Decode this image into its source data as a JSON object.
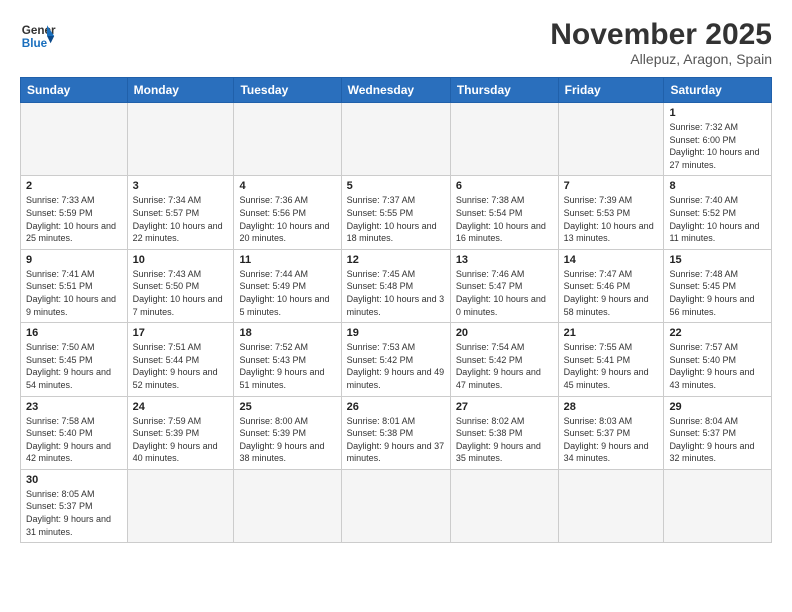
{
  "logo": {
    "line1": "General",
    "line2": "Blue"
  },
  "title": "November 2025",
  "location": "Allepuz, Aragon, Spain",
  "weekdays": [
    "Sunday",
    "Monday",
    "Tuesday",
    "Wednesday",
    "Thursday",
    "Friday",
    "Saturday"
  ],
  "weeks": [
    [
      {
        "day": "",
        "info": ""
      },
      {
        "day": "",
        "info": ""
      },
      {
        "day": "",
        "info": ""
      },
      {
        "day": "",
        "info": ""
      },
      {
        "day": "",
        "info": ""
      },
      {
        "day": "",
        "info": ""
      },
      {
        "day": "1",
        "info": "Sunrise: 7:32 AM\nSunset: 6:00 PM\nDaylight: 10 hours and 27 minutes."
      }
    ],
    [
      {
        "day": "2",
        "info": "Sunrise: 7:33 AM\nSunset: 5:59 PM\nDaylight: 10 hours and 25 minutes."
      },
      {
        "day": "3",
        "info": "Sunrise: 7:34 AM\nSunset: 5:57 PM\nDaylight: 10 hours and 22 minutes."
      },
      {
        "day": "4",
        "info": "Sunrise: 7:36 AM\nSunset: 5:56 PM\nDaylight: 10 hours and 20 minutes."
      },
      {
        "day": "5",
        "info": "Sunrise: 7:37 AM\nSunset: 5:55 PM\nDaylight: 10 hours and 18 minutes."
      },
      {
        "day": "6",
        "info": "Sunrise: 7:38 AM\nSunset: 5:54 PM\nDaylight: 10 hours and 16 minutes."
      },
      {
        "day": "7",
        "info": "Sunrise: 7:39 AM\nSunset: 5:53 PM\nDaylight: 10 hours and 13 minutes."
      },
      {
        "day": "8",
        "info": "Sunrise: 7:40 AM\nSunset: 5:52 PM\nDaylight: 10 hours and 11 minutes."
      }
    ],
    [
      {
        "day": "9",
        "info": "Sunrise: 7:41 AM\nSunset: 5:51 PM\nDaylight: 10 hours and 9 minutes."
      },
      {
        "day": "10",
        "info": "Sunrise: 7:43 AM\nSunset: 5:50 PM\nDaylight: 10 hours and 7 minutes."
      },
      {
        "day": "11",
        "info": "Sunrise: 7:44 AM\nSunset: 5:49 PM\nDaylight: 10 hours and 5 minutes."
      },
      {
        "day": "12",
        "info": "Sunrise: 7:45 AM\nSunset: 5:48 PM\nDaylight: 10 hours and 3 minutes."
      },
      {
        "day": "13",
        "info": "Sunrise: 7:46 AM\nSunset: 5:47 PM\nDaylight: 10 hours and 0 minutes."
      },
      {
        "day": "14",
        "info": "Sunrise: 7:47 AM\nSunset: 5:46 PM\nDaylight: 9 hours and 58 minutes."
      },
      {
        "day": "15",
        "info": "Sunrise: 7:48 AM\nSunset: 5:45 PM\nDaylight: 9 hours and 56 minutes."
      }
    ],
    [
      {
        "day": "16",
        "info": "Sunrise: 7:50 AM\nSunset: 5:45 PM\nDaylight: 9 hours and 54 minutes."
      },
      {
        "day": "17",
        "info": "Sunrise: 7:51 AM\nSunset: 5:44 PM\nDaylight: 9 hours and 52 minutes."
      },
      {
        "day": "18",
        "info": "Sunrise: 7:52 AM\nSunset: 5:43 PM\nDaylight: 9 hours and 51 minutes."
      },
      {
        "day": "19",
        "info": "Sunrise: 7:53 AM\nSunset: 5:42 PM\nDaylight: 9 hours and 49 minutes."
      },
      {
        "day": "20",
        "info": "Sunrise: 7:54 AM\nSunset: 5:42 PM\nDaylight: 9 hours and 47 minutes."
      },
      {
        "day": "21",
        "info": "Sunrise: 7:55 AM\nSunset: 5:41 PM\nDaylight: 9 hours and 45 minutes."
      },
      {
        "day": "22",
        "info": "Sunrise: 7:57 AM\nSunset: 5:40 PM\nDaylight: 9 hours and 43 minutes."
      }
    ],
    [
      {
        "day": "23",
        "info": "Sunrise: 7:58 AM\nSunset: 5:40 PM\nDaylight: 9 hours and 42 minutes."
      },
      {
        "day": "24",
        "info": "Sunrise: 7:59 AM\nSunset: 5:39 PM\nDaylight: 9 hours and 40 minutes."
      },
      {
        "day": "25",
        "info": "Sunrise: 8:00 AM\nSunset: 5:39 PM\nDaylight: 9 hours and 38 minutes."
      },
      {
        "day": "26",
        "info": "Sunrise: 8:01 AM\nSunset: 5:38 PM\nDaylight: 9 hours and 37 minutes."
      },
      {
        "day": "27",
        "info": "Sunrise: 8:02 AM\nSunset: 5:38 PM\nDaylight: 9 hours and 35 minutes."
      },
      {
        "day": "28",
        "info": "Sunrise: 8:03 AM\nSunset: 5:37 PM\nDaylight: 9 hours and 34 minutes."
      },
      {
        "day": "29",
        "info": "Sunrise: 8:04 AM\nSunset: 5:37 PM\nDaylight: 9 hours and 32 minutes."
      }
    ],
    [
      {
        "day": "30",
        "info": "Sunrise: 8:05 AM\nSunset: 5:37 PM\nDaylight: 9 hours and 31 minutes."
      },
      {
        "day": "",
        "info": ""
      },
      {
        "day": "",
        "info": ""
      },
      {
        "day": "",
        "info": ""
      },
      {
        "day": "",
        "info": ""
      },
      {
        "day": "",
        "info": ""
      },
      {
        "day": "",
        "info": ""
      }
    ]
  ]
}
